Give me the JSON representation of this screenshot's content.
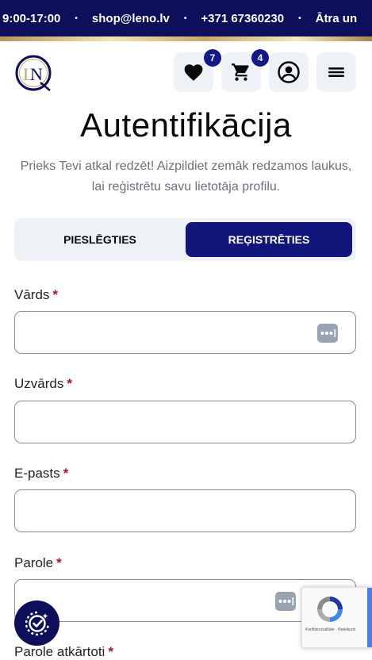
{
  "topbar": {
    "hours": "9:00-17:00",
    "email": "shop@leno.lv",
    "phone": "+371 67360230",
    "delivery": "Ātra un",
    "separator": "•"
  },
  "header": {
    "logo_alt": "LN",
    "wishlist_count": "7",
    "cart_count": "4"
  },
  "page": {
    "title": "Autentifikācija",
    "subtitle": "Prieks Tevi atkal redzēt! Aizpildiet zemāk redzamos laukus, lai reģistrētu savu lietotāja profilu."
  },
  "tabs": {
    "login": "PIESLĒGTIES",
    "register": "REĢISTRĒTIES",
    "active": "register"
  },
  "form": {
    "required_mark": "*",
    "fields": [
      {
        "label": "Vārds",
        "value": ""
      },
      {
        "label": "Uzvārds",
        "value": ""
      },
      {
        "label": "E-pasts",
        "value": ""
      },
      {
        "label": "Parole",
        "value": ""
      },
      {
        "label": "Parole atkārtoti",
        "value": ""
      }
    ]
  },
  "recaptcha": {
    "text": "Konfidencialitāte - Noteikumi"
  },
  "colors": {
    "brand_navy": "#0d0f5a",
    "active_tab": "#12157a",
    "required": "#a31621"
  }
}
